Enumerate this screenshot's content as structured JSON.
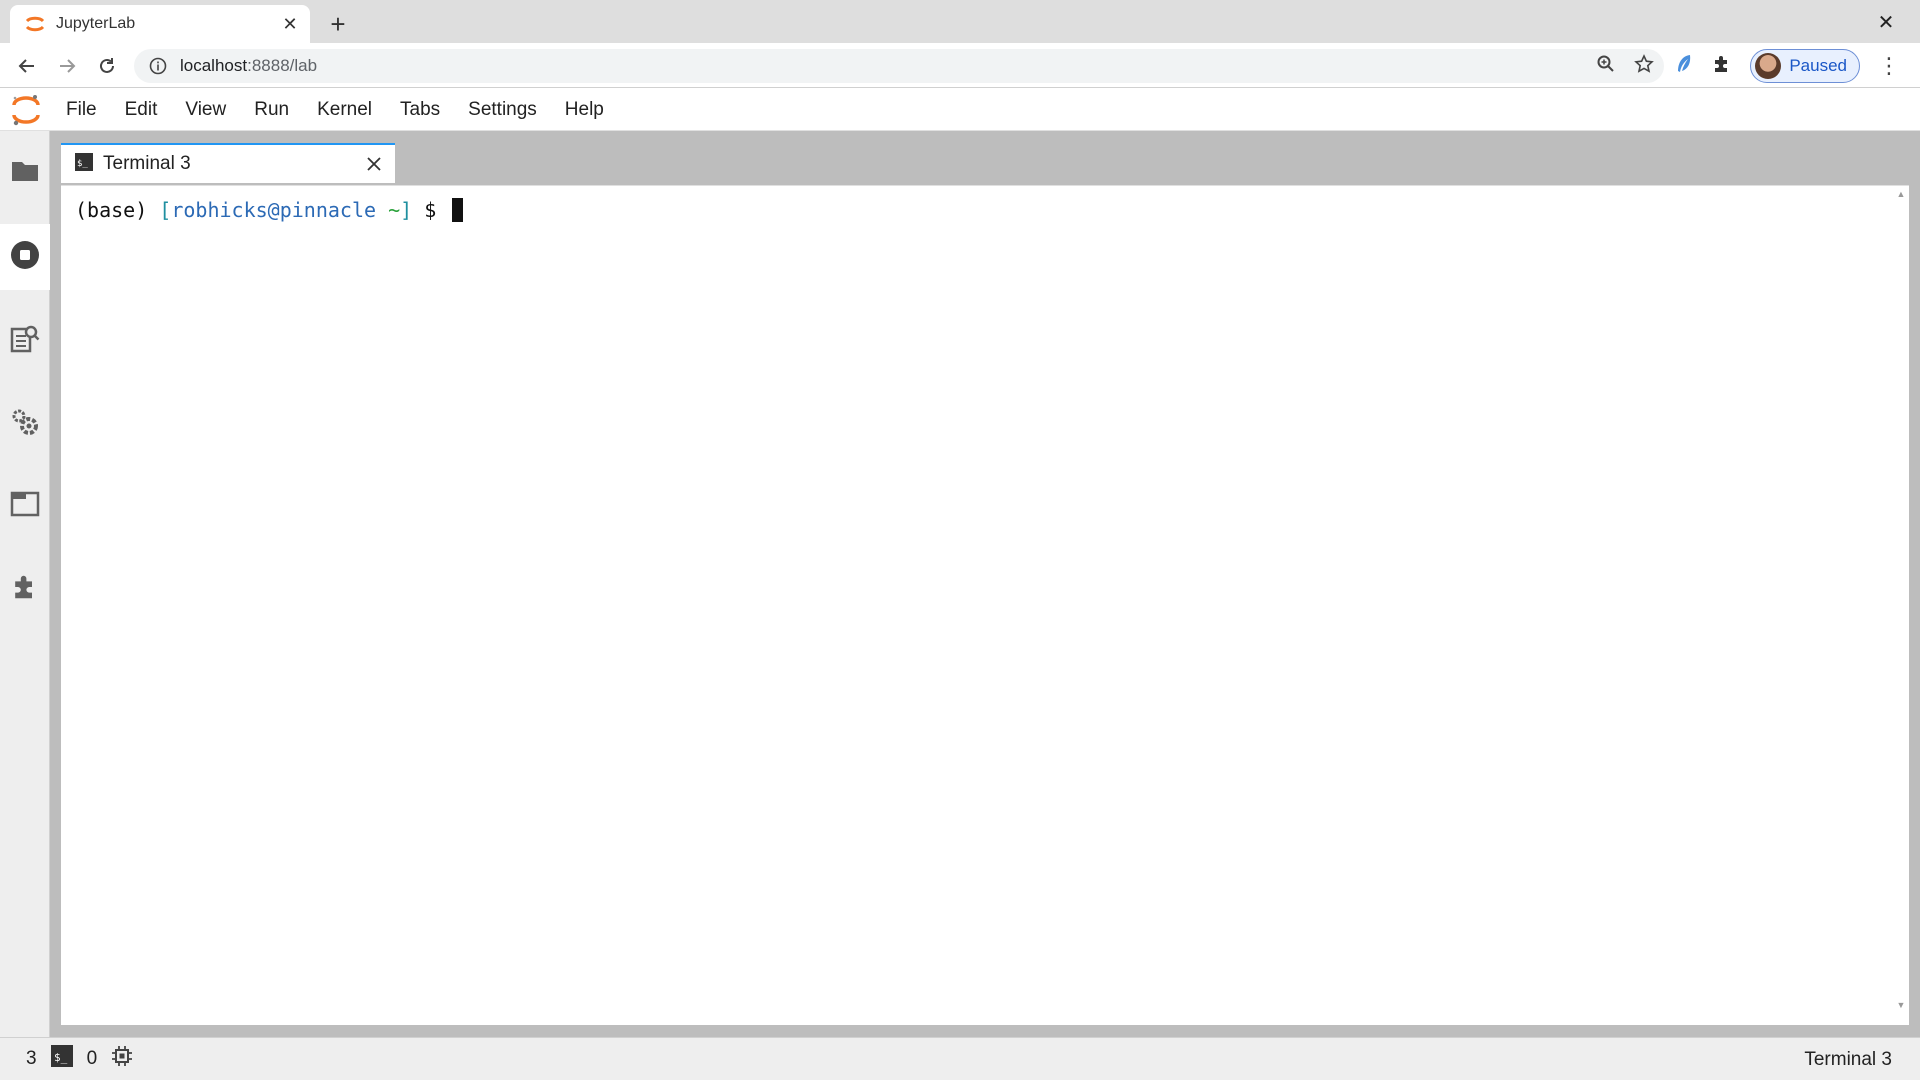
{
  "browser": {
    "tab_title": "JupyterLab",
    "url_host": "localhost",
    "url_path": ":8888/lab",
    "profile_label": "Paused",
    "accent_color": "#1a57c7"
  },
  "menu": {
    "items": [
      "File",
      "Edit",
      "View",
      "Run",
      "Kernel",
      "Tabs",
      "Settings",
      "Help"
    ]
  },
  "sidebar": {
    "icons": [
      "folder-icon",
      "stop-circle-icon",
      "property-inspector-icon",
      "settings-gears-icon",
      "tabs-icon",
      "extension-puzzle-icon"
    ]
  },
  "main": {
    "tab_label": "Terminal 3",
    "terminal": {
      "prefix": "(base) ",
      "bracket_open": "[",
      "user_host": "robhicks@pinnacle",
      "space": " ",
      "cwd": "~",
      "bracket_close": "]",
      "prompt": " $ "
    }
  },
  "statusbar": {
    "terminals_count": "3",
    "kernels_count": "0",
    "active_label": "Terminal 3"
  },
  "colors": {
    "tab_accent": "#2196f3",
    "jupyter_orange": "#f37726"
  }
}
